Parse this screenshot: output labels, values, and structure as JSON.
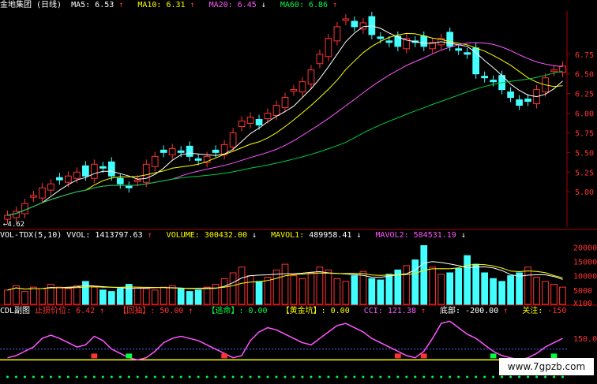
{
  "header": {
    "stock_name": "金地集团",
    "period": "(日线)",
    "ma5_label": "MA5:",
    "ma5_value": "6.53",
    "ma5_arrow": "↑",
    "ma10_label": "MA10:",
    "ma10_value": "6.31",
    "ma10_arrow": "↑",
    "ma20_label": "MA20:",
    "ma20_value": "6.45",
    "ma20_arrow": "↓",
    "ma60_label": "MA60:",
    "ma60_value": "6.86",
    "ma60_arrow": "↑"
  },
  "price_axis": [
    "6.75",
    "6.50",
    "6.25",
    "6.00",
    "5.75",
    "5.50",
    "5.25",
    "5.00"
  ],
  "low_marker": "←4.62",
  "volume_header": {
    "indicator": "VOL-TDX(5,10)",
    "vvol_label": "VVOL:",
    "vvol_value": "1413797.63",
    "vvol_arrow": "↑",
    "volume_label": "VOLUME:",
    "volume_value": "300432.00",
    "volume_arrow": "↓",
    "mavol1_label": "MAVOL1:",
    "mavol1_value": "489958.41",
    "mavol1_arrow": "↓",
    "mavol2_label": "MAVOL2:",
    "mavol2_value": "584531.19",
    "mavol2_arrow": "↓"
  },
  "volume_axis": [
    "20000",
    "15000",
    "10000",
    "5000",
    "X100"
  ],
  "cdl_header": {
    "title": "CDL副图",
    "stop_label": "止损价位:",
    "stop_value": "6.42",
    "stop_arrow": "↑",
    "pullback_label": "【回抽】:",
    "pullback_value": "50.00",
    "pullback_arrow": "↑",
    "escape_label": "【逃命】:",
    "escape_value": "0.00",
    "gold_label": "【黄金坑】:",
    "gold_value": "0.00",
    "cci_label": "CCI:",
    "cci_value": "121.38",
    "cci_arrow": "↑",
    "bottom_label": "底部:",
    "bottom_value": "-200.00",
    "bottom_arrow": "↑",
    "watch_label": "关注:",
    "watch_value": "-150"
  },
  "cdl_axis": [
    "150.00"
  ],
  "watermark": "www.7gpzb.com",
  "colors": {
    "up": "#ff3333",
    "down": "#44ffff",
    "ma5": "#ffffff",
    "ma10": "#ffff00",
    "ma20": "#ff55ff",
    "ma60": "#00cc44",
    "cci": "#ff55ff"
  },
  "chart_data": {
    "type": "candlestick",
    "close_prices": [
      4.7,
      4.75,
      4.85,
      4.95,
      5.05,
      5.1,
      5.15,
      5.2,
      5.25,
      5.2,
      5.35,
      5.3,
      5.2,
      5.1,
      5.05,
      5.15,
      5.35,
      5.45,
      5.5,
      5.55,
      5.5,
      5.45,
      5.4,
      5.45,
      5.5,
      5.6,
      5.75,
      5.9,
      5.95,
      5.85,
      6.0,
      6.1,
      6.2,
      6.3,
      6.4,
      6.55,
      6.75,
      6.95,
      7.1,
      7.2,
      7.1,
      7.15,
      7.0,
      6.95,
      6.9,
      6.85,
      6.95,
      6.9,
      6.85,
      6.9,
      6.95,
      6.85,
      6.8,
      6.75,
      6.5,
      6.45,
      6.4,
      6.3,
      6.2,
      6.1,
      6.15,
      6.3,
      6.45,
      6.55,
      6.6
    ],
    "volume_values": [
      5000,
      6500,
      4500,
      6000,
      5500,
      7000,
      6000,
      5500,
      6500,
      8000,
      6000,
      5000,
      4500,
      5500,
      7000,
      6000,
      5500,
      5000,
      6000,
      6500,
      5500,
      4500,
      5000,
      6000,
      7000,
      9000,
      11000,
      13000,
      10000,
      8000,
      9500,
      12000,
      14000,
      10000,
      9000,
      11000,
      13000,
      12000,
      9000,
      8000,
      10000,
      11500,
      9000,
      8500,
      10500,
      12000,
      13500,
      15500,
      20500,
      13000,
      10500,
      11000,
      12500,
      17000,
      14000,
      11000,
      9000,
      8000,
      10000,
      11000,
      13000,
      9500,
      8000,
      7000,
      6000
    ],
    "cci_values": [
      60,
      70,
      90,
      110,
      150,
      165,
      150,
      130,
      110,
      120,
      160,
      140,
      100,
      80,
      60,
      50,
      60,
      90,
      130,
      150,
      160,
      150,
      140,
      120,
      100,
      80,
      60,
      70,
      140,
      180,
      200,
      190,
      170,
      150,
      130,
      120,
      150,
      180,
      210,
      220,
      200,
      180,
      150,
      130,
      110,
      90,
      70,
      60,
      90,
      150,
      220,
      230,
      200,
      170,
      150,
      120,
      90,
      70,
      60,
      50,
      60,
      80,
      110,
      130,
      150
    ]
  }
}
